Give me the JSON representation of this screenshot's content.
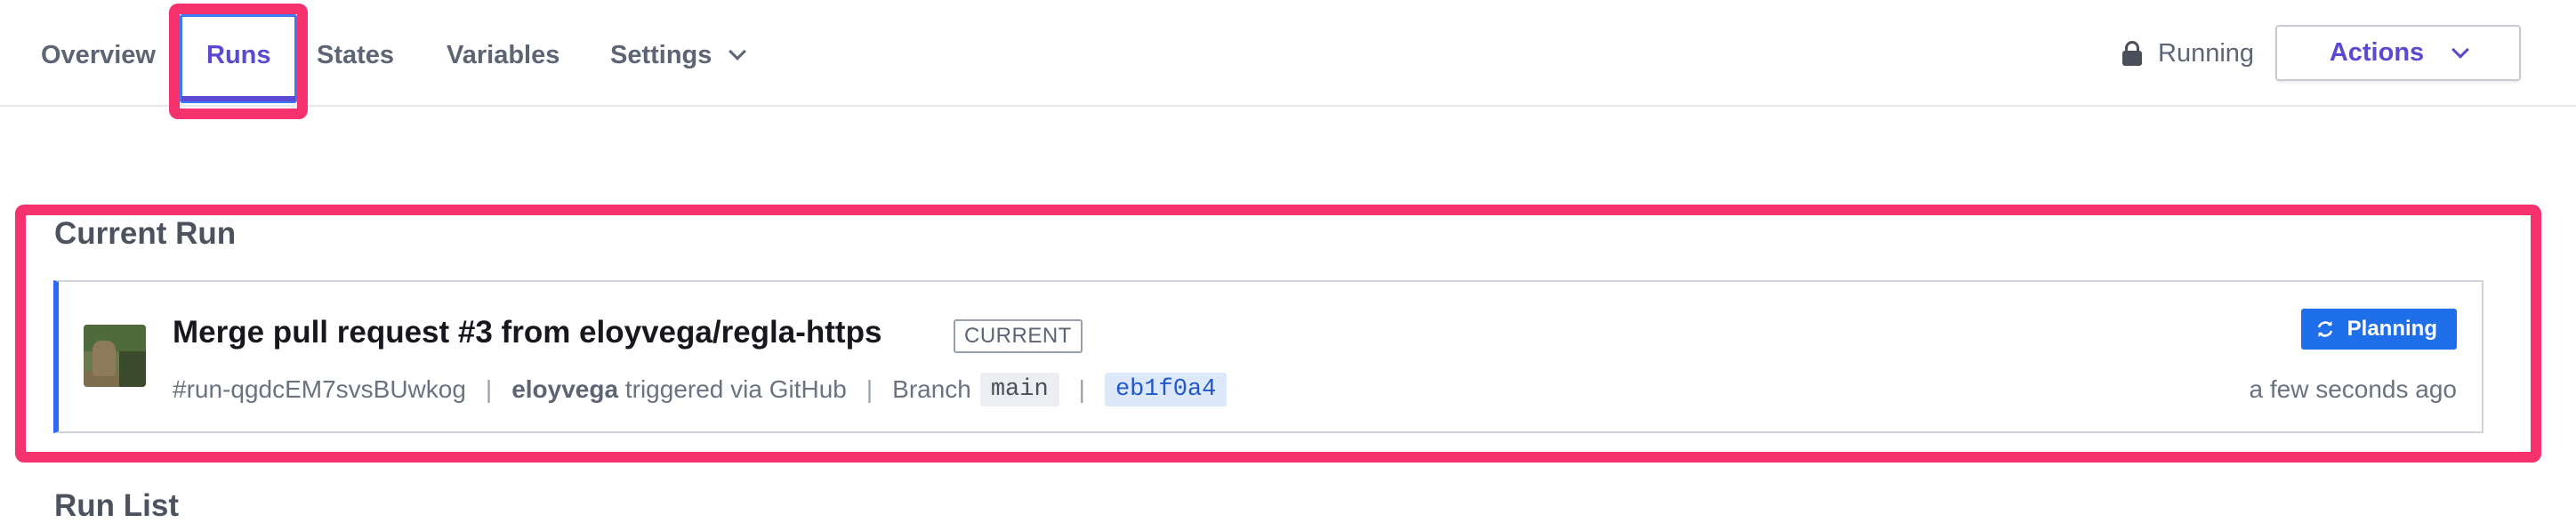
{
  "nav": {
    "tabs": [
      {
        "label": "Overview"
      },
      {
        "label": "Runs",
        "active": true
      },
      {
        "label": "States"
      },
      {
        "label": "Variables"
      },
      {
        "label": "Settings"
      }
    ],
    "lock_status": "Running",
    "actions_label": "Actions",
    "icons": {
      "lock": "lock-icon",
      "chevron": "chevron-down-icon"
    }
  },
  "current_run": {
    "section_title": "Current Run",
    "title": "Merge pull request #3 from eloyvega/regla-https",
    "badge": "CURRENT",
    "run_id": "#run-qgdcEM7svsBUwkog",
    "user": "eloyvega",
    "trigger_text": "triggered via GitHub",
    "branch_label": "Branch",
    "branch": "main",
    "commit": "eb1f0a4",
    "status_label": "Planning",
    "time_ago": "a few seconds ago",
    "separator": "|"
  },
  "run_list": {
    "title": "Run List"
  },
  "colors": {
    "accent": "#5b4ad1",
    "highlight": "#f5326e",
    "card_border_left": "#2b6bf3",
    "status_button": "#1f6feb"
  }
}
